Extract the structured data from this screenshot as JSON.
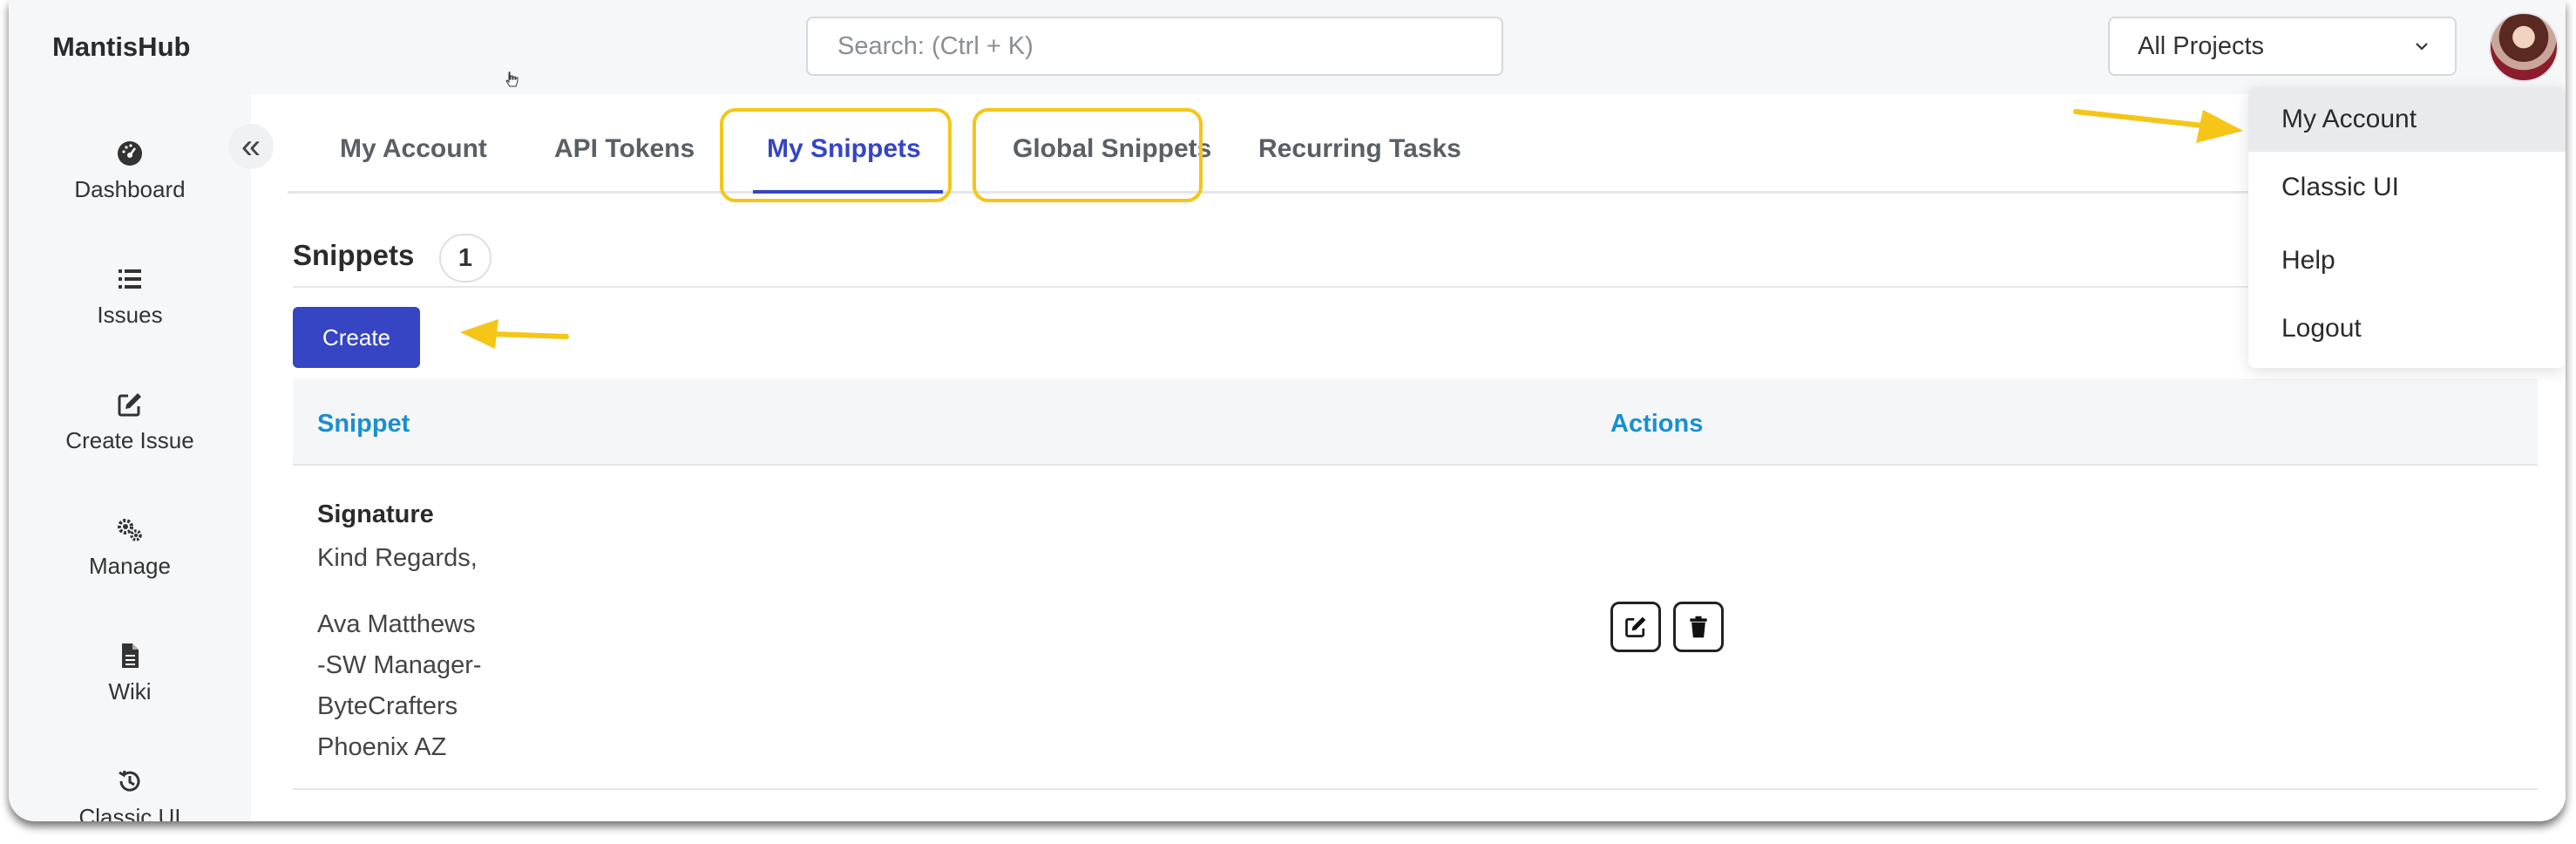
{
  "app": {
    "title": "MantisHub"
  },
  "search": {
    "placeholder": "Search: (Ctrl + K)"
  },
  "project_selector": {
    "value": "All Projects"
  },
  "sidebar": {
    "items": [
      {
        "label": "Dashboard",
        "icon": "dashboard-icon"
      },
      {
        "label": "Issues",
        "icon": "list-icon"
      },
      {
        "label": "Create Issue",
        "icon": "edit-icon"
      },
      {
        "label": "Manage",
        "icon": "gears-icon"
      },
      {
        "label": "Wiki",
        "icon": "document-icon"
      },
      {
        "label": "Classic UI",
        "icon": "history-icon"
      }
    ]
  },
  "tabs": [
    {
      "label": "My Account"
    },
    {
      "label": "API Tokens"
    },
    {
      "label": "My Snippets",
      "active": true
    },
    {
      "label": "Global Snippets"
    },
    {
      "label": "Recurring Tasks"
    }
  ],
  "snippets": {
    "title": "Snippets",
    "count": "1",
    "create_label": "Create",
    "columns": [
      "Snippet",
      "Actions"
    ],
    "rows": [
      {
        "title": "Signature",
        "lines": [
          "Kind Regards,",
          "Ava Matthews",
          "-SW Manager-",
          "ByteCrafters",
          "Phoenix AZ"
        ]
      }
    ]
  },
  "user_menu": {
    "items": [
      {
        "label": "My Account",
        "active": true
      },
      {
        "label": "Classic UI"
      },
      {
        "label": "Help"
      },
      {
        "label": "Logout"
      }
    ]
  },
  "colors": {
    "accent": "#3545c4",
    "link": "#1a8fd0",
    "highlight": "#f5c518"
  }
}
